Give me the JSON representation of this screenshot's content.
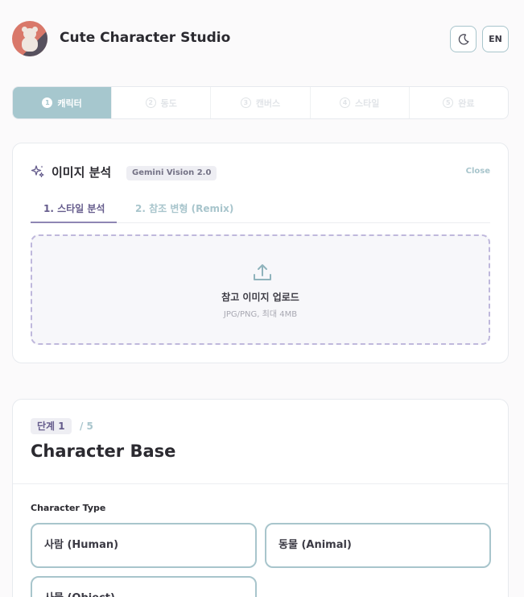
{
  "app": {
    "title": "Cute Character Studio",
    "lang_label": "EN"
  },
  "stepper": {
    "steps": [
      {
        "num": "1",
        "label": "캐릭터",
        "active": true
      },
      {
        "num": "2",
        "label": "동도",
        "active": false
      },
      {
        "num": "3",
        "label": "캔버스",
        "active": false
      },
      {
        "num": "4",
        "label": "스타일",
        "active": false
      },
      {
        "num": "5",
        "label": "완료",
        "active": false
      }
    ]
  },
  "analysis": {
    "title": "이미지 분석",
    "model_badge": "Gemini Vision 2.0",
    "close_label": "Close",
    "tabs": [
      {
        "label": "1. 스타일 분석",
        "active": true
      },
      {
        "label": "2. 참조 변형 (Remix)",
        "active": false
      }
    ],
    "upload": {
      "title": "참고 이미지 업로드",
      "hint": "JPG/PNG, 최대 4MB"
    }
  },
  "step_card": {
    "badge": "단계 1",
    "total": "/ 5",
    "title": "Character Base",
    "field_label": "Character Type",
    "options": [
      "사람 (Human)",
      "동물 (Animal)",
      "사물 (Object)"
    ]
  },
  "colors": {
    "accent": "#a6c7ce",
    "purple": "#8e86b4",
    "text": "#2b2a30"
  },
  "icons": {
    "theme": "moon-icon",
    "analysis": "sparkle-icon",
    "upload": "upload-icon"
  }
}
